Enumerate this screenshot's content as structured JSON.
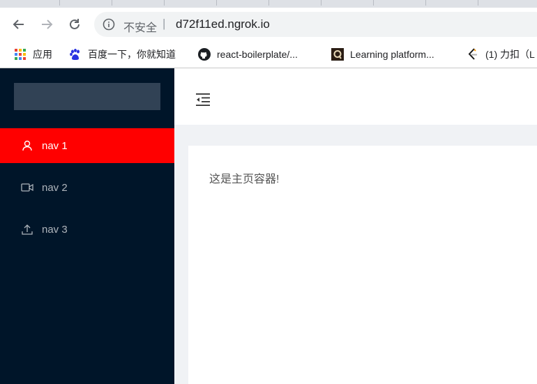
{
  "browser": {
    "security_label": "不安全",
    "separator": "|",
    "url": "d72f11ed.ngrok.io"
  },
  "bookmarks": [
    {
      "label": "应用",
      "icon": "apps-grid-icon"
    },
    {
      "label": "百度一下，你就知道",
      "icon": "baidu-paw-icon"
    },
    {
      "label": "react-boilerplate/...",
      "icon": "github-icon"
    },
    {
      "label": "Learning platform...",
      "icon": "q-logo-icon"
    },
    {
      "label": "(1) 力扣（L",
      "icon": "leetcode-icon"
    }
  ],
  "sidebar": {
    "items": [
      {
        "label": "nav 1",
        "icon": "user-icon",
        "active": true
      },
      {
        "label": "nav 2",
        "icon": "video-camera-icon",
        "active": false
      },
      {
        "label": "nav 3",
        "icon": "upload-icon",
        "active": false
      }
    ]
  },
  "main": {
    "content_text": "这是主页容器!"
  },
  "colors": {
    "sider_bg": "#001529",
    "active_item": "#ff0000",
    "layout_bg": "#f0f2f5"
  }
}
